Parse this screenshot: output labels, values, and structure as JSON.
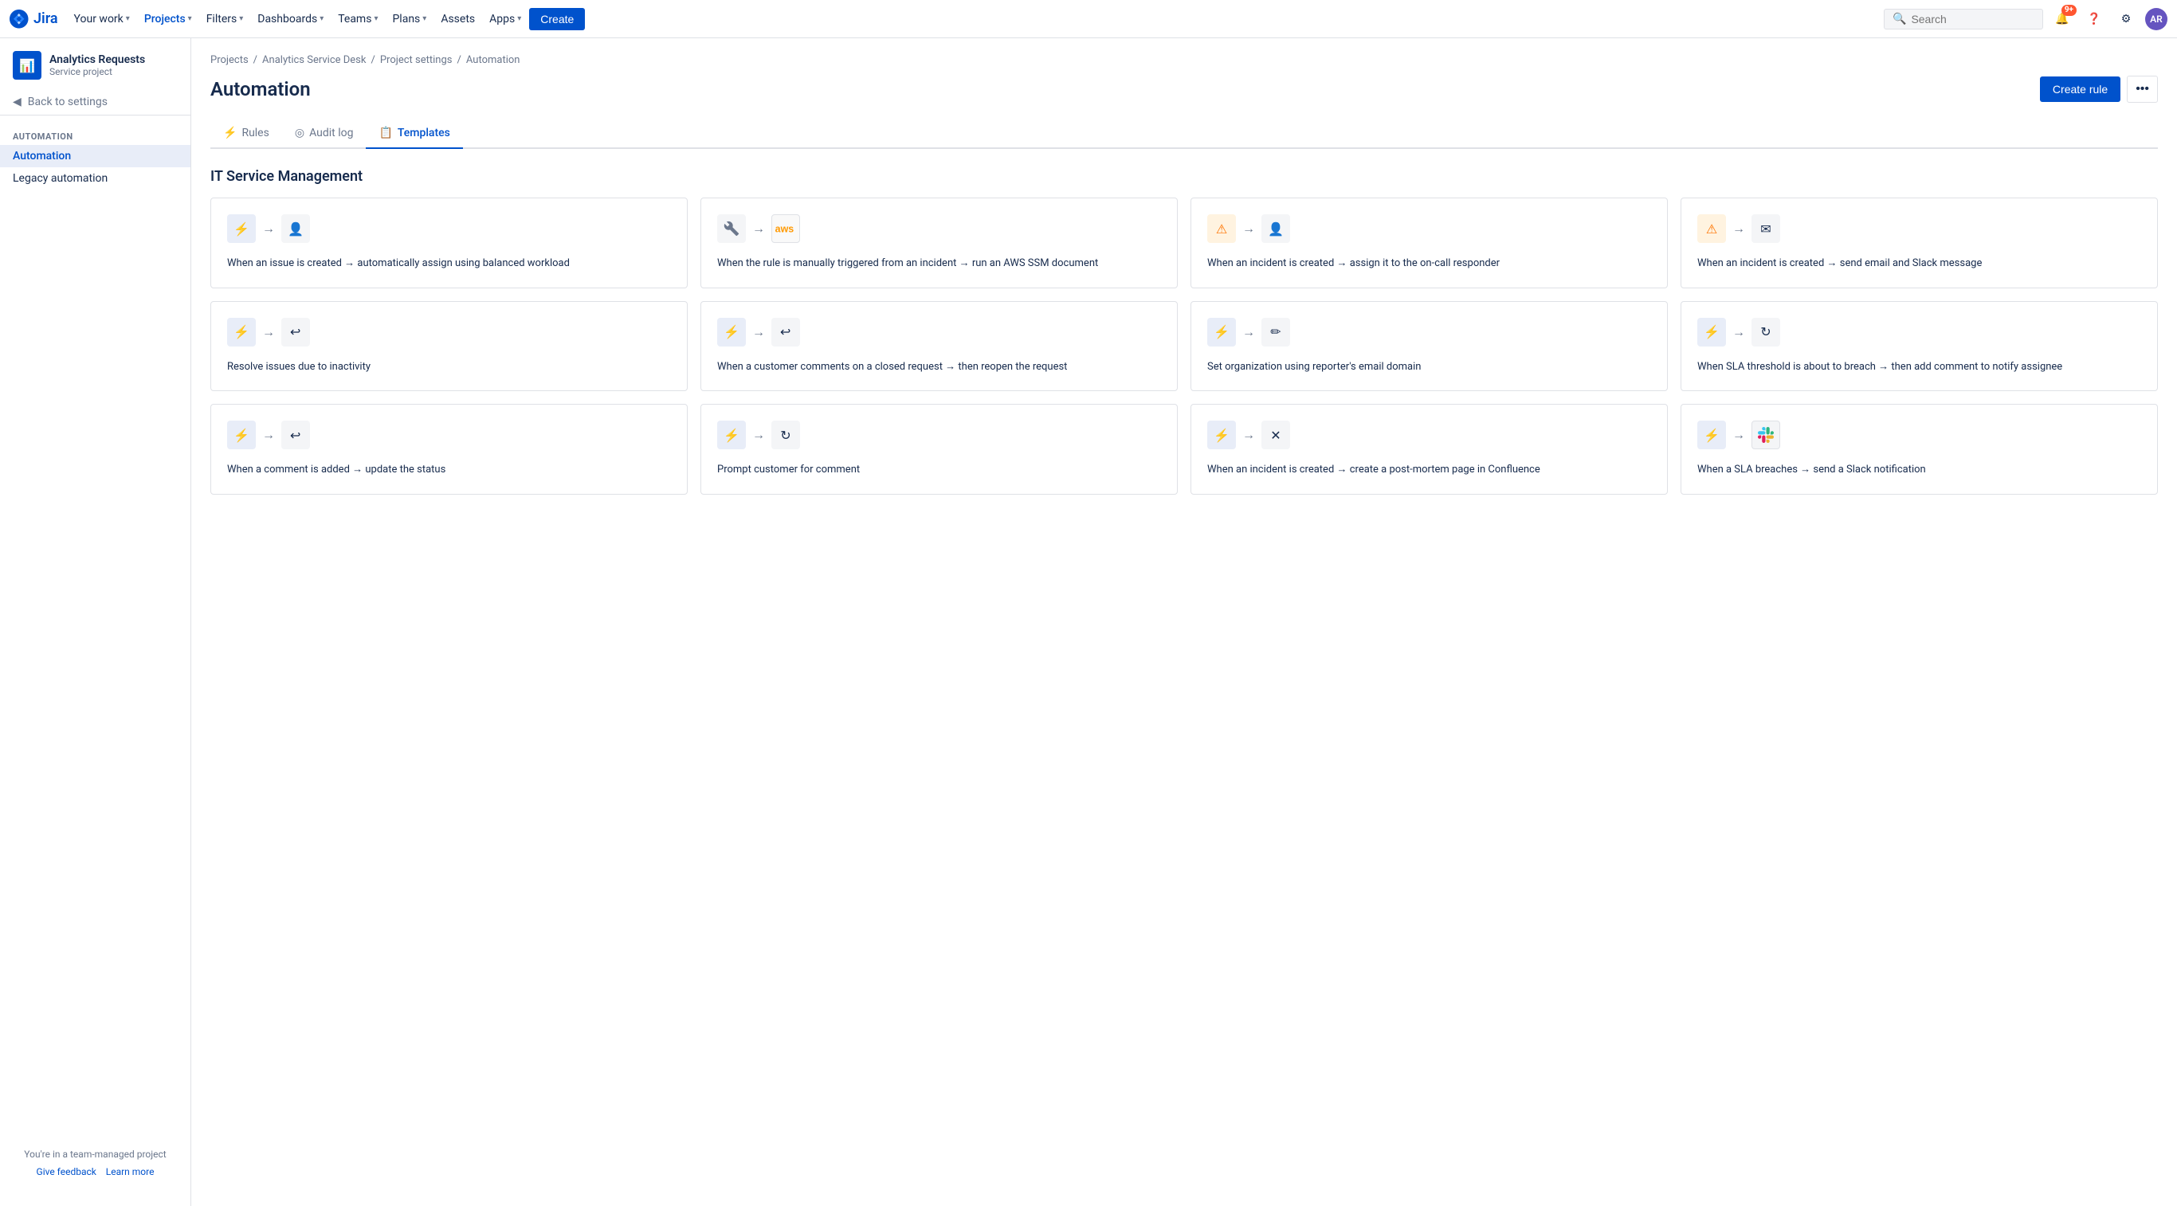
{
  "nav": {
    "logo_text": "Jira",
    "items": [
      {
        "label": "Your work",
        "has_dropdown": true,
        "active": false
      },
      {
        "label": "Projects",
        "has_dropdown": true,
        "active": true
      },
      {
        "label": "Filters",
        "has_dropdown": true,
        "active": false
      },
      {
        "label": "Dashboards",
        "has_dropdown": true,
        "active": false
      },
      {
        "label": "Teams",
        "has_dropdown": true,
        "active": false
      },
      {
        "label": "Plans",
        "has_dropdown": true,
        "active": false
      },
      {
        "label": "Assets",
        "has_dropdown": false,
        "active": false
      },
      {
        "label": "Apps",
        "has_dropdown": true,
        "active": false
      }
    ],
    "create_label": "Create",
    "search_placeholder": "Search",
    "notification_badge": "9+",
    "avatar_initials": "AR"
  },
  "sidebar": {
    "project_name": "Analytics Requests",
    "project_type": "Service project",
    "back_label": "Back to settings",
    "section_title": "AUTOMATION",
    "items": [
      {
        "label": "Automation",
        "active": true
      },
      {
        "label": "Legacy automation",
        "active": false
      }
    ],
    "footer_line1": "You're in a team-managed project",
    "give_feedback": "Give feedback",
    "learn_more": "Learn more"
  },
  "breadcrumb": {
    "items": [
      "Projects",
      "Analytics Service Desk",
      "Project settings",
      "Automation"
    ]
  },
  "page": {
    "title": "Automation",
    "create_rule_label": "Create rule",
    "more_icon": "•••"
  },
  "tabs": [
    {
      "label": "Rules",
      "icon": "⚡",
      "active": false
    },
    {
      "label": "Audit log",
      "icon": "◎",
      "active": false
    },
    {
      "label": "Templates",
      "icon": "📋",
      "active": true
    }
  ],
  "section_title": "IT Service Management",
  "cards_row1": [
    {
      "icon1": "⚡",
      "icon1_style": "blue",
      "icon2": "👤",
      "icon2_style": "gray",
      "text": "When an issue is created → automatically assign using balanced workload"
    },
    {
      "icon1": "🔧",
      "icon1_style": "gray",
      "icon2": "aws",
      "icon2_style": "aws",
      "text": "When the rule is manually triggered from an incident → run an AWS SSM document"
    },
    {
      "icon1": "⚠",
      "icon1_style": "orange",
      "icon2": "👤",
      "icon2_style": "gray",
      "text": "When an incident is created → assign it to the on-call responder"
    },
    {
      "icon1": "⚠",
      "icon1_style": "orange",
      "icon2": "✉",
      "icon2_style": "gray",
      "text": "When an incident is created → send email and Slack message"
    }
  ],
  "cards_row2": [
    {
      "icon1": "⚡",
      "icon1_style": "blue",
      "icon2": "↩",
      "icon2_style": "gray",
      "text": "Resolve issues due to inactivity"
    },
    {
      "icon1": "⚡",
      "icon1_style": "blue",
      "icon2": "↩",
      "icon2_style": "gray",
      "text": "When a customer comments on a closed request → then reopen the request"
    },
    {
      "icon1": "⚡",
      "icon1_style": "blue",
      "icon2": "✏",
      "icon2_style": "gray",
      "text": "Set organization using reporter's email domain"
    },
    {
      "icon1": "⚡",
      "icon1_style": "blue",
      "icon2": "↻",
      "icon2_style": "gray",
      "text": "When SLA threshold is about to breach → then add comment to notify assignee"
    }
  ],
  "cards_row3": [
    {
      "icon1": "⚡",
      "icon1_style": "blue",
      "icon2": "↩",
      "icon2_style": "gray",
      "text": "When a comment is added → update the status"
    },
    {
      "icon1": "⚡",
      "icon1_style": "blue",
      "icon2": "↻",
      "icon2_style": "gray",
      "text": "Prompt customer for comment"
    },
    {
      "icon1": "⚡",
      "icon1_style": "blue",
      "icon2": "✕",
      "icon2_style": "gray",
      "text": "When an incident is created → create a post-mortem page in Confluence"
    },
    {
      "icon1": "⚡",
      "icon1_style": "blue",
      "icon2": "slack",
      "icon2_style": "slack",
      "text": "When a SLA breaches → send a Slack notification"
    }
  ]
}
